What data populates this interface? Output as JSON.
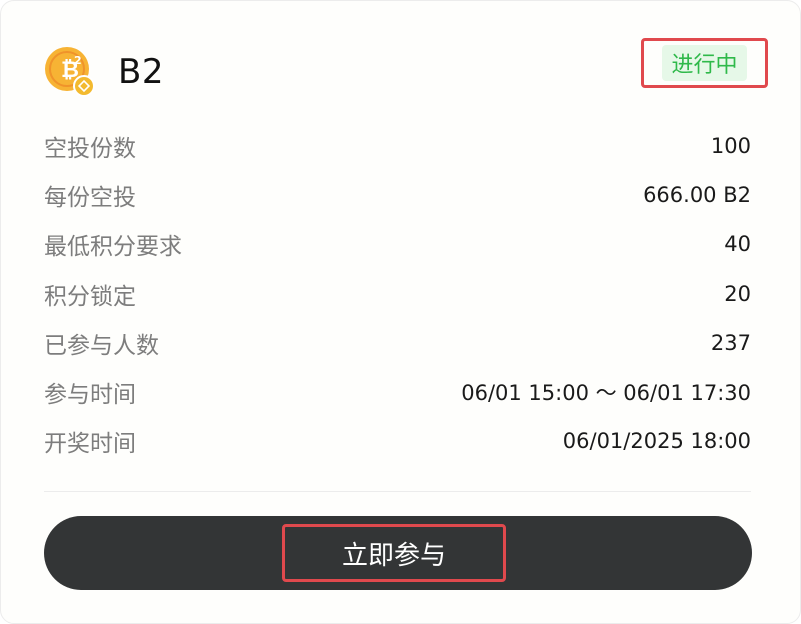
{
  "token": {
    "name": "B2",
    "logo_icon": "bitcoin-b2-icon",
    "logo_badge_icon": "bnb-chain-icon"
  },
  "status": {
    "label": "进行中",
    "text_color": "#2fb94a",
    "bg_color": "#e6f8e8"
  },
  "details": [
    {
      "label": "空投份数",
      "value": "100"
    },
    {
      "label": "每份空投",
      "value": "666.00 B2"
    },
    {
      "label": "最低积分要求",
      "value": "40"
    },
    {
      "label": "积分锁定",
      "value": "20"
    },
    {
      "label": "已参与人数",
      "value": "237"
    },
    {
      "label": "参与时间",
      "value": "06/01 15:00 ～ 06/01 17:30"
    },
    {
      "label": "开奖时间",
      "value": "06/01/2025 18:00"
    }
  ],
  "join_button": {
    "label": "立即参与",
    "bg_color": "#333536"
  },
  "highlight_color": "#e0494d"
}
